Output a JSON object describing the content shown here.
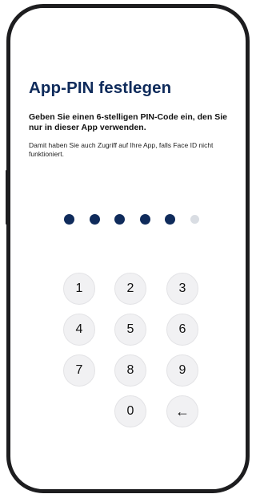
{
  "screen": {
    "title": "App-PIN festlegen",
    "subtitle": "Geben Sie einen 6-stelligen PIN-Code ein, den Sie nur in dieser App verwenden.",
    "info": "Damit haben Sie auch Zugriff auf Ihre App, falls Face ID nicht funktioniert."
  },
  "pin": {
    "length": 6,
    "entered": 5,
    "filled_color": "#0f2b5b",
    "empty_color": "#d9dde3"
  },
  "keypad": {
    "keys": [
      {
        "label": "1"
      },
      {
        "label": "2"
      },
      {
        "label": "3"
      },
      {
        "label": "4"
      },
      {
        "label": "5"
      },
      {
        "label": "6"
      },
      {
        "label": "7"
      },
      {
        "label": "8"
      },
      {
        "label": "9"
      },
      {
        "label": "0"
      },
      {
        "label": "←",
        "icon": "backspace-arrow-icon"
      }
    ]
  },
  "colors": {
    "accent": "#0f2b5b",
    "frame": "#1d1d1f",
    "key_background": "#f1f1f3"
  }
}
